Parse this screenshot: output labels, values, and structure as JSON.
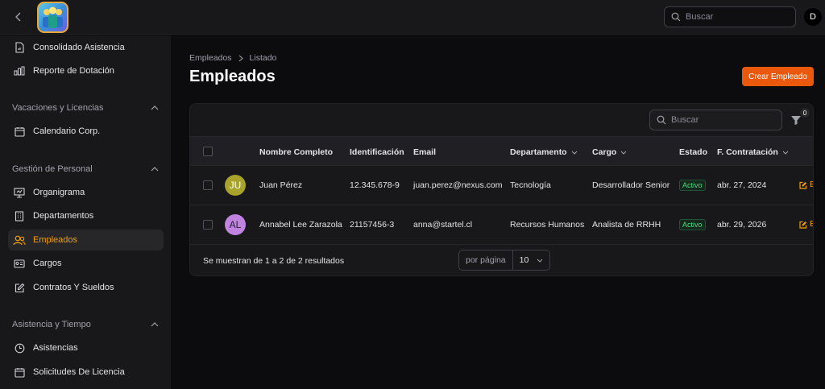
{
  "topbar": {
    "search_placeholder": "Buscar",
    "user_initial": "D"
  },
  "sidebar": {
    "items_top": [
      {
        "label": "Consolidado Asistencia",
        "icon": "file-chart-icon"
      },
      {
        "label": "Reporte de Dotación",
        "icon": "bar-chart-icon"
      }
    ],
    "sections": [
      {
        "title": "Vacaciones y Licencias",
        "items": [
          {
            "label": "Calendario Corp.",
            "icon": "calendar-icon"
          }
        ]
      },
      {
        "title": "Gestión de Personal",
        "items": [
          {
            "label": "Organigrama",
            "icon": "presentation-icon"
          },
          {
            "label": "Departamentos",
            "icon": "building-icon"
          },
          {
            "label": "Empleados",
            "icon": "users-icon",
            "active": true
          },
          {
            "label": "Cargos",
            "icon": "id-card-icon"
          },
          {
            "label": "Contratos Y Sueldos",
            "icon": "edit-icon"
          }
        ]
      },
      {
        "title": "Asistencia y Tiempo",
        "items": [
          {
            "label": "Asistencias",
            "icon": "clock-icon"
          },
          {
            "label": "Solicitudes De Licencia",
            "icon": "calendar-icon"
          }
        ]
      }
    ]
  },
  "main": {
    "breadcrumb": [
      "Empleados",
      "Listado"
    ],
    "title": "Empleados",
    "create_button": "Crear Empleado",
    "table": {
      "search_placeholder": "Buscar",
      "filter_count": "0",
      "columns": [
        "Nombre Completo",
        "Identificación",
        "Email",
        "Departamento",
        "Cargo",
        "Estado",
        "F. Contratación"
      ],
      "rows": [
        {
          "initials": "JU",
          "avatar_color": "#a8a32a",
          "name": "Juan Pérez",
          "id": "12.345.678-9",
          "email": "juan.perez@nexus.com",
          "department": "Tecnología",
          "position": "Desarrollador Senior",
          "status": "Activo",
          "hire_date": "abr. 27, 2024",
          "action": "E"
        },
        {
          "initials": "AL",
          "avatar_color": "#c084e0",
          "name": "Annabel Lee Zarazola",
          "id": "21157456-3",
          "email": "anna@startel.cl",
          "department": "Recursos Humanos",
          "position": "Analista de RRHH",
          "status": "Activo",
          "hire_date": "abr. 29, 2026",
          "action": "E"
        }
      ],
      "footer_text": "Se muestran de 1 a 2 de 2 resultados",
      "per_page_label": "por página",
      "per_page_value": "10"
    }
  },
  "colors": {
    "accent": "#f59e0b",
    "primary_button": "#ea580c",
    "status_active": "#4ade80"
  }
}
